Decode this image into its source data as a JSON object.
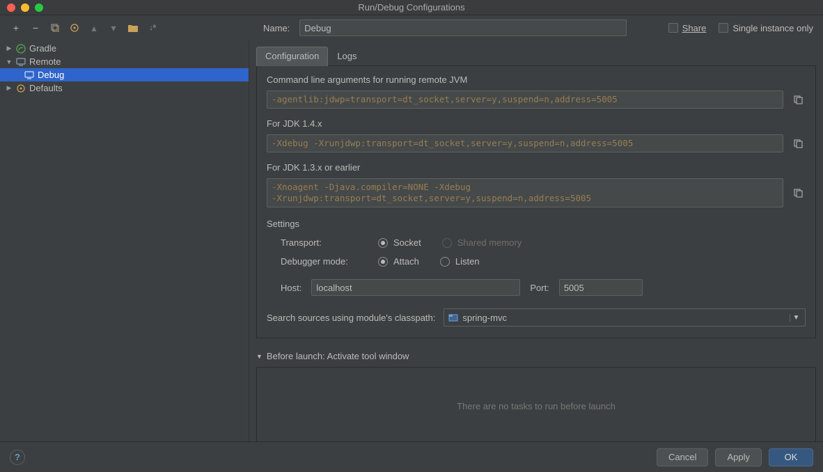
{
  "window": {
    "title": "Run/Debug Configurations"
  },
  "toolbar": {
    "add": "+",
    "remove": "−"
  },
  "tree": {
    "items": [
      {
        "label": "Gradle"
      },
      {
        "label": "Remote"
      },
      {
        "label": "Debug"
      },
      {
        "label": "Defaults"
      }
    ]
  },
  "header": {
    "name_label": "Name:",
    "name_value": "Debug",
    "share_label": "Share",
    "single_instance_label": "Single instance only"
  },
  "tabs": {
    "configuration": "Configuration",
    "logs": "Logs"
  },
  "config": {
    "cmd_label": "Command line arguments for running remote JVM",
    "cmd_value": "-agentlib:jdwp=transport=dt_socket,server=y,suspend=n,address=5005",
    "jdk14_label": "For JDK 1.4.x",
    "jdk14_value": "-Xdebug -Xrunjdwp:transport=dt_socket,server=y,suspend=n,address=5005",
    "jdk13_label": "For JDK 1.3.x or earlier",
    "jdk13_value": "-Xnoagent -Djava.compiler=NONE -Xdebug\n-Xrunjdwp:transport=dt_socket,server=y,suspend=n,address=5005",
    "settings_label": "Settings",
    "transport_label": "Transport:",
    "transport_socket": "Socket",
    "transport_shared": "Shared memory",
    "mode_label": "Debugger mode:",
    "mode_attach": "Attach",
    "mode_listen": "Listen",
    "host_label": "Host:",
    "host_value": "localhost",
    "port_label": "Port:",
    "port_value": "5005",
    "module_label": "Search sources using module's classpath:",
    "module_value": "spring-mvc"
  },
  "before_launch": {
    "header": "Before launch: Activate tool window",
    "empty": "There are no tasks to run before launch"
  },
  "buttons": {
    "cancel": "Cancel",
    "apply": "Apply",
    "ok": "OK"
  }
}
